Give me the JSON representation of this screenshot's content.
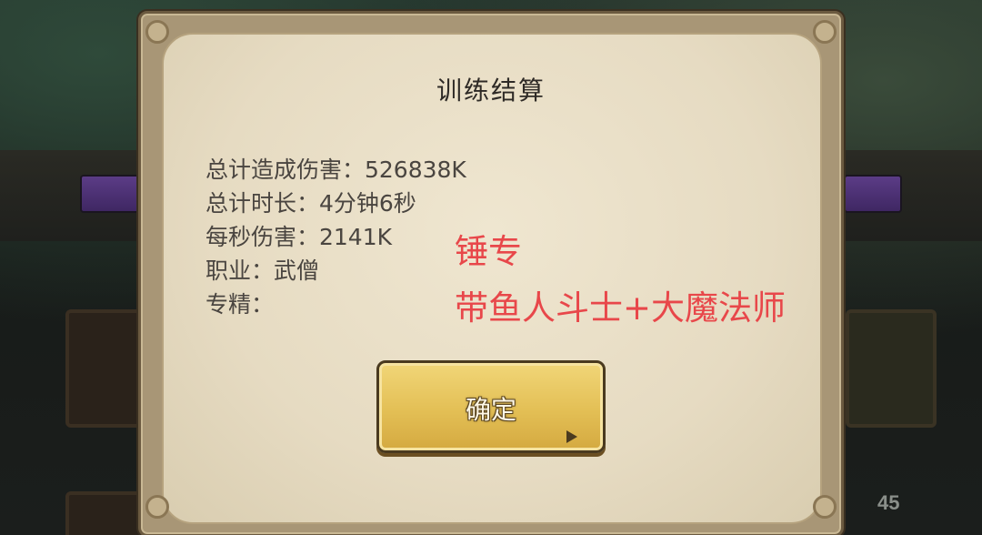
{
  "dialog": {
    "title": "训练结算",
    "stats": {
      "total_damage": "总计造成伤害：526838K",
      "total_time": "总计时长：4分钟6秒",
      "dps": "每秒伤害：2141K",
      "class": "职业：武僧",
      "specialty": "专精："
    },
    "confirm_label": "确定"
  },
  "annotation": {
    "line1": "锤专",
    "line2": "带鱼人斗士+大魔法师",
    "color": "#e8474a"
  },
  "background": {
    "counter": "45"
  }
}
